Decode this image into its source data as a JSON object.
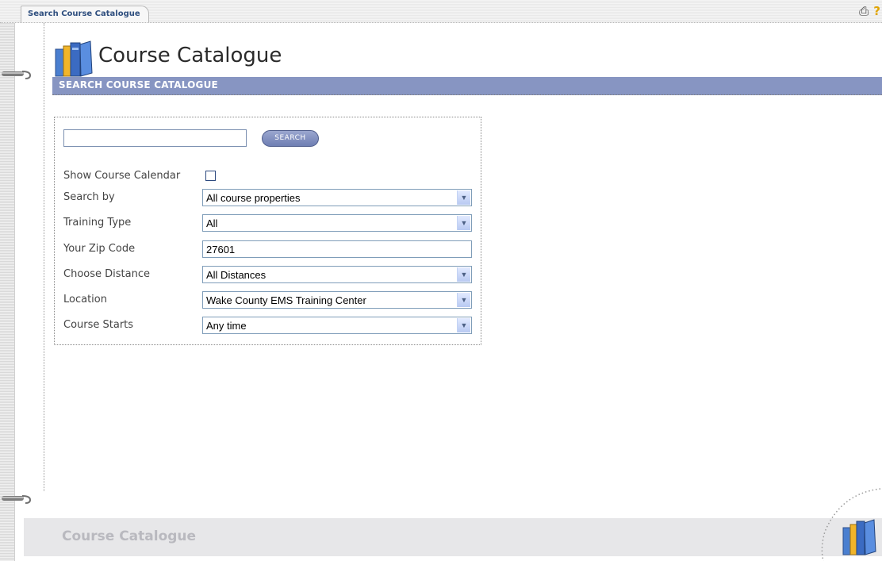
{
  "tab": {
    "label": "Search Course Catalogue"
  },
  "header": {
    "title": "Course Catalogue",
    "section_title": "SEARCH COURSE CATALOGUE"
  },
  "search": {
    "input_value": "",
    "button_label": "SEARCH",
    "show_calendar_label": "Show Course Calendar",
    "show_calendar_checked": false,
    "fields": [
      {
        "label": "Search by",
        "value": "All course properties",
        "type": "select"
      },
      {
        "label": "Training Type",
        "value": "All",
        "type": "select"
      },
      {
        "label": "Your Zip Code",
        "value": "27601",
        "type": "text"
      },
      {
        "label": "Choose Distance",
        "value": "All Distances",
        "type": "select"
      },
      {
        "label": "Location",
        "value": "Wake County EMS Training Center",
        "type": "select"
      },
      {
        "label": "Course Starts",
        "value": "Any time",
        "type": "select"
      }
    ]
  },
  "footer": {
    "title": "Course Catalogue"
  },
  "icons": {
    "print": "printer-icon",
    "help": "help-icon",
    "books": "books-icon"
  },
  "colors": {
    "section_bar": "#8795c2",
    "footer": "#e7e7e9",
    "tab_text": "#2f4f7f"
  }
}
